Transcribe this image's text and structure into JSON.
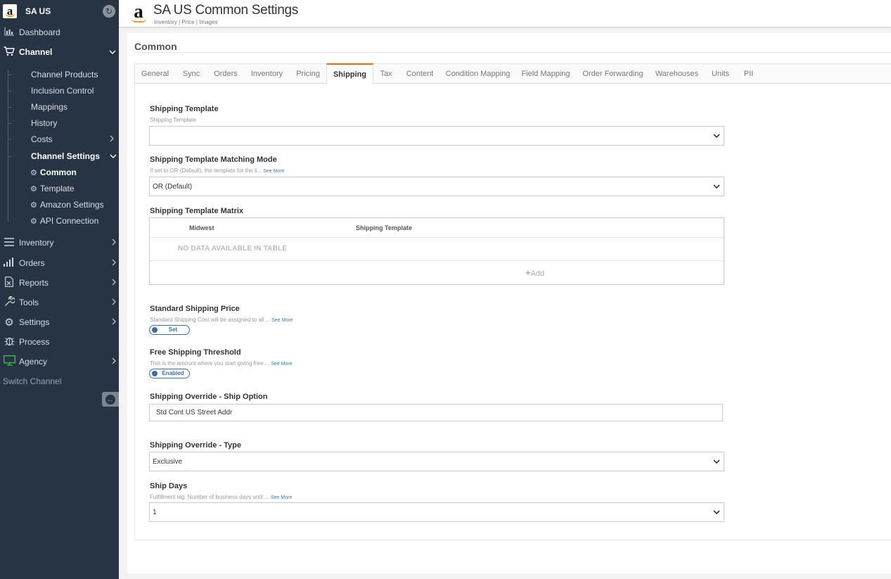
{
  "sidebar": {
    "title": "SA US",
    "logo_letter": "a",
    "items": [
      {
        "label": "Dashboard",
        "icon": "bar-chart-icon"
      },
      {
        "label": "Channel",
        "icon": "cart-icon"
      },
      {
        "label": "Inventory",
        "icon": "list-icon"
      },
      {
        "label": "Orders",
        "icon": "signal-bars-icon"
      },
      {
        "label": "Reports",
        "icon": "excel-file-icon"
      },
      {
        "label": "Tools",
        "icon": "wrench-icon"
      },
      {
        "label": "Settings",
        "icon": "gear-icon"
      },
      {
        "label": "Process",
        "icon": "bug-icon"
      },
      {
        "label": "Agency",
        "icon": "monitor-icon"
      }
    ],
    "channel_sub": [
      {
        "label": "Channel Products"
      },
      {
        "label": "Inclusion Control"
      },
      {
        "label": "Mappings"
      },
      {
        "label": "History"
      },
      {
        "label": "Costs"
      },
      {
        "label": "Channel Settings"
      }
    ],
    "channel_settings_sub": [
      {
        "label": "Common"
      },
      {
        "label": "Template"
      },
      {
        "label": "Amazon Settings"
      },
      {
        "label": "API Connection"
      }
    ],
    "switch_channel": "Switch Channel"
  },
  "header": {
    "logo_letter": "a",
    "title": "SA US Common Settings",
    "subtitle": "Inventory | Price | Images"
  },
  "section_title": "Common",
  "tabs": [
    "General",
    "Sync",
    "Orders",
    "Inventory",
    "Pricing",
    "Shipping",
    "Tax",
    "Content",
    "Condition Mapping",
    "Field Mapping",
    "Order Forwarding",
    "Warehouses",
    "Units",
    "PII"
  ],
  "active_tab": "Shipping",
  "form": {
    "shipping_template": {
      "label": "Shipping Template",
      "help": "Shipping Template",
      "value": ""
    },
    "matching_mode": {
      "label": "Shipping Template Matching Mode",
      "help": "If set to OR (Default), the template for the li...",
      "see_more": "See More",
      "value": "OR (Default)"
    },
    "matrix": {
      "label": "Shipping Template Matrix",
      "col1": "Midwest",
      "col2": "Shipping Template",
      "empty": "NO DATA AVAILABLE IN TABLE",
      "add": "Add"
    },
    "standard_price": {
      "label": "Standard Shipping Price",
      "help": "Standard Shipping Cost will be assigned to all ...",
      "see_more": "See More",
      "toggle": "Set"
    },
    "free_threshold": {
      "label": "Free Shipping Threshold",
      "help": "This is the amount where you start giving free ...",
      "see_more": "See More",
      "toggle": "Enabled"
    },
    "ship_option": {
      "label": "Shipping Override - Ship Option",
      "value": "Std Cont US Street Addr"
    },
    "override_type": {
      "label": "Shipping Override - Type",
      "value": "Exclusive"
    },
    "ship_days": {
      "label": "Ship Days",
      "help": "Fulfillment lag. Number of business days until ...",
      "see_more": "See More",
      "value": "1"
    }
  },
  "colors": {
    "sidebar_bg": "#263444",
    "active_tab_accent": "#e4671b",
    "toggle": "#3a6ea5",
    "logo_smile": "#f39c12"
  }
}
